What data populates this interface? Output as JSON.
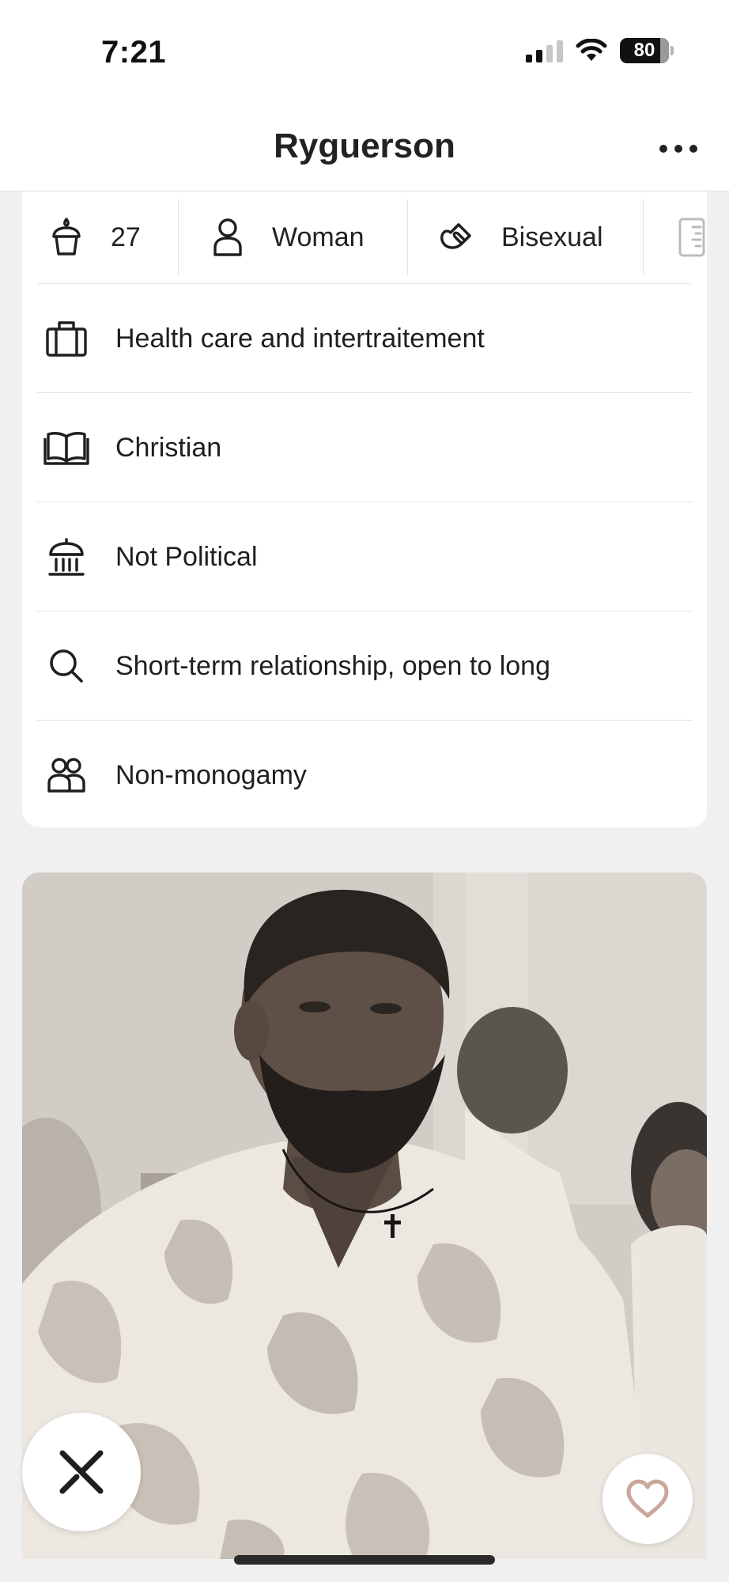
{
  "status_bar": {
    "time": "7:21",
    "battery": "80"
  },
  "header": {
    "title": "Ryguerson",
    "more_icon": "ellipsis-icon"
  },
  "chips": [
    {
      "icon": "cake-icon",
      "label": "27"
    },
    {
      "icon": "person-icon",
      "label": "Woman"
    },
    {
      "icon": "magnet-icon",
      "label": "Bisexual"
    },
    {
      "icon": "ruler-icon",
      "label": ""
    }
  ],
  "rows": [
    {
      "icon": "briefcase-icon",
      "label": "Health care and intertraitement"
    },
    {
      "icon": "book-icon",
      "label": "Christian"
    },
    {
      "icon": "government-building-icon",
      "label": "Not Political"
    },
    {
      "icon": "search-icon",
      "label": "Short-term relationship, open to long"
    },
    {
      "icon": "people-icon",
      "label": "Non-monogamy"
    }
  ],
  "actions": {
    "pass_icon": "close-icon",
    "like_icon": "heart-icon"
  }
}
